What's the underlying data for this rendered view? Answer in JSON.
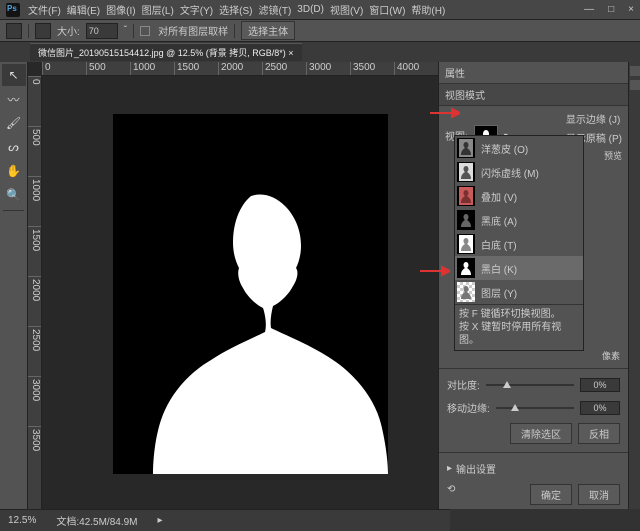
{
  "menu": {
    "items": [
      "文件(F)",
      "编辑(E)",
      "图像(I)",
      "图层(L)",
      "文字(Y)",
      "选择(S)",
      "滤镜(T)",
      "3D(D)",
      "视图(V)",
      "窗口(W)",
      "帮助(H)"
    ]
  },
  "win": {
    "min": "—",
    "max": "□",
    "close": "×"
  },
  "opt": {
    "size_label": "大小:",
    "size_val": "70",
    "sample_label": "对所有图层取样",
    "subject": "选择主体"
  },
  "tab": {
    "title": "微信图片_20190515154412.jpg @ 12.5% (背景 拷贝, RGB/8*) ×"
  },
  "ruler_h": [
    "0",
    "500",
    "1000",
    "1500",
    "2000",
    "2500",
    "3000",
    "3500",
    "4000"
  ],
  "ruler_v": [
    "0",
    "500",
    "1000",
    "1500",
    "2000",
    "2500",
    "3000",
    "3500"
  ],
  "panel": {
    "title": "属性",
    "subtitle": "视图模式",
    "view_label": "视图:",
    "show_edge_label": "显示边缘 (J)",
    "show_orig_label": "显示原稿 (P)",
    "preview_btn": "预览"
  },
  "dropdown": {
    "items": [
      {
        "name": "洋葱皮 (O)",
        "th": "onion"
      },
      {
        "name": "闪烁虚线 (M)",
        "th": "marq"
      },
      {
        "name": "叠加 (V)",
        "th": "overlay"
      },
      {
        "name": "黑底 (A)",
        "th": "black"
      },
      {
        "name": "白底 (T)",
        "th": "white"
      },
      {
        "name": "黑白 (K)",
        "th": "bw"
      },
      {
        "name": "图层 (Y)",
        "th": "layer"
      }
    ],
    "selected": 5,
    "foot1": "按 F 键循环切换视图。",
    "foot2": "按 X 键暂时停用所有视图。"
  },
  "sliders": {
    "pixel_label": "像素",
    "contrast_label": "对比度:",
    "contrast_val": "0%",
    "shift_label": "移动边缘:",
    "shift_val": "0%"
  },
  "btns": {
    "clear": "清除选区",
    "invert": "反相",
    "output": "输出设置",
    "ok": "确定",
    "cancel": "取消"
  },
  "status": {
    "zoom": "12.5%",
    "doc": "文档:42.5M/84.9M"
  }
}
